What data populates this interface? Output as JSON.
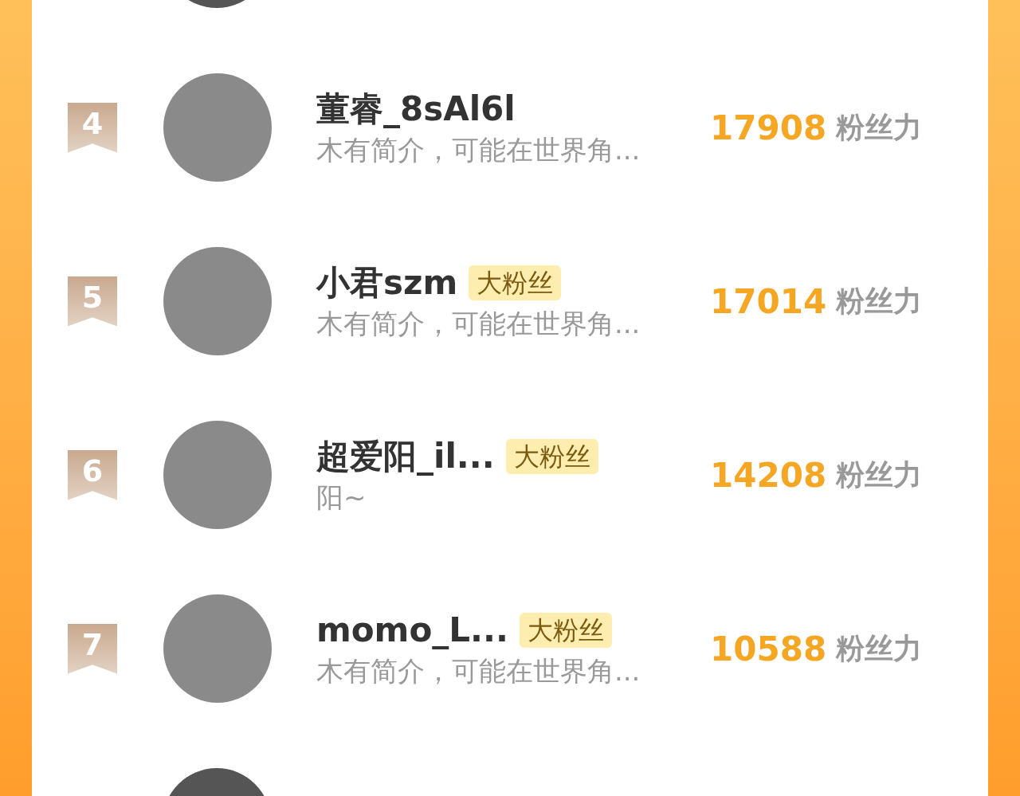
{
  "rows": [
    {
      "kind": "cut"
    },
    {
      "kind": "full",
      "rank": "4",
      "name": "董睿_8sAl6l",
      "bio": "木有简介，可能在世界角...",
      "score": "17908",
      "score_unit": "粉丝力"
    },
    {
      "kind": "full",
      "rank": "5",
      "name": "小君szm",
      "badge": "大粉丝",
      "bio": "木有简介，可能在世界角...",
      "score": "17014",
      "score_unit": "粉丝力"
    },
    {
      "kind": "full",
      "rank": "6",
      "name": "超爱阳_il...",
      "badge": "大粉丝",
      "bio": "阳~",
      "score": "14208",
      "score_unit": "粉丝力"
    },
    {
      "kind": "full",
      "rank": "7",
      "name": "momo_L...",
      "badge": "大粉丝",
      "bio": "木有简介，可能在世界角...",
      "score": "10588",
      "score_unit": "粉丝力"
    },
    {
      "kind": "cut"
    }
  ]
}
